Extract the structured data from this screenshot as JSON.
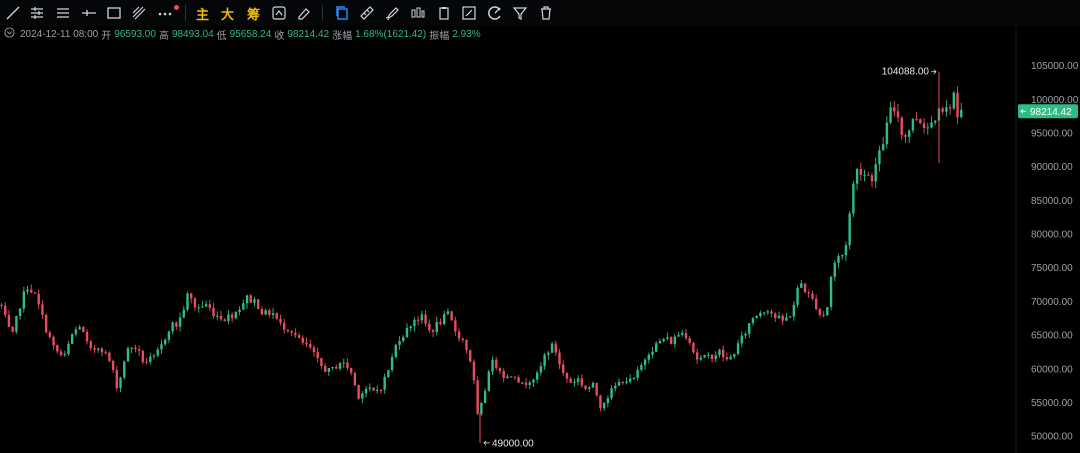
{
  "toolbar": {
    "tools": [
      "trend-line-icon",
      "horizontal-lines-icon",
      "parallel-lines-icon",
      "horizontal-ray-icon",
      "rectangle-icon",
      "fibonacci-icon",
      "more-icon"
    ],
    "indicators": {
      "main": "主",
      "big": "大",
      "chips": "筹"
    },
    "right_tools": [
      "copy-icon",
      "ruler-icon",
      "brush-icon",
      "candle-icon",
      "clipboard-icon",
      "note-icon",
      "magnet-icon",
      "filter-icon",
      "trash-icon"
    ]
  },
  "info": {
    "datetime": "2024-12-11 08:00",
    "open_label": "开",
    "open": "96593.00",
    "high_label": "高",
    "high": "98493.04",
    "low_label": "低",
    "low": "95658.24",
    "close_label": "收",
    "close": "98214.42",
    "change_label": "涨幅",
    "change": "1.68%(1621.42)",
    "amplitude_label": "振幅",
    "amplitude": "2.93%"
  },
  "colors": {
    "up": "#2ebd85",
    "down": "#e84d5f",
    "axis_text": "#9aa0a6",
    "price_tag": "#2ebd85"
  },
  "chart_data": {
    "type": "candlestick",
    "ylim": [
      47500,
      108500
    ],
    "yticks": [
      "105000.00",
      "100000.00",
      "95000.00",
      "90000.00",
      "85000.00",
      "80000.00",
      "75000.00",
      "70000.00",
      "65000.00",
      "60000.00",
      "55000.00",
      "50000.00"
    ],
    "last_price": "98214.42",
    "high_marker": {
      "label": "104088.00",
      "value": 104088
    },
    "low_marker": {
      "label": "49000.00",
      "value": 49000
    },
    "close_path": [
      [
        0,
        70000
      ],
      [
        6,
        67000
      ],
      [
        12,
        64500
      ],
      [
        20,
        69500
      ],
      [
        28,
        72500
      ],
      [
        36,
        70500
      ],
      [
        46,
        66000
      ],
      [
        54,
        63000
      ],
      [
        64,
        61500
      ],
      [
        72,
        65000
      ],
      [
        80,
        66500
      ],
      [
        90,
        62500
      ],
      [
        100,
        63500
      ],
      [
        110,
        61000
      ],
      [
        118,
        57000
      ],
      [
        126,
        62500
      ],
      [
        134,
        63500
      ],
      [
        144,
        61000
      ],
      [
        154,
        61500
      ],
      [
        162,
        63500
      ],
      [
        170,
        66500
      ],
      [
        178,
        66500
      ],
      [
        188,
        71000
      ],
      [
        196,
        69000
      ],
      [
        206,
        69500
      ],
      [
        216,
        68000
      ],
      [
        226,
        67500
      ],
      [
        236,
        68500
      ],
      [
        246,
        70500
      ],
      [
        256,
        70000
      ],
      [
        264,
        68000
      ],
      [
        272,
        68500
      ],
      [
        280,
        66500
      ],
      [
        290,
        66000
      ],
      [
        300,
        64000
      ],
      [
        310,
        63000
      ],
      [
        320,
        60500
      ],
      [
        330,
        59500
      ],
      [
        340,
        61000
      ],
      [
        350,
        60000
      ],
      [
        358,
        56000
      ],
      [
        366,
        57000
      ],
      [
        374,
        56500
      ],
      [
        382,
        57500
      ],
      [
        390,
        60500
      ],
      [
        398,
        64500
      ],
      [
        406,
        65500
      ],
      [
        414,
        67500
      ],
      [
        422,
        67500
      ],
      [
        430,
        65500
      ],
      [
        440,
        67000
      ],
      [
        448,
        68000
      ],
      [
        456,
        65500
      ],
      [
        464,
        64000
      ],
      [
        472,
        60500
      ],
      [
        478,
        52500
      ],
      [
        484,
        56000
      ],
      [
        490,
        61000
      ],
      [
        498,
        60500
      ],
      [
        506,
        58500
      ],
      [
        514,
        59500
      ],
      [
        522,
        57500
      ],
      [
        530,
        58500
      ],
      [
        538,
        59000
      ],
      [
        546,
        62500
      ],
      [
        554,
        63500
      ],
      [
        562,
        59500
      ],
      [
        570,
        58000
      ],
      [
        578,
        58500
      ],
      [
        586,
        57000
      ],
      [
        594,
        57500
      ],
      [
        600,
        54500
      ],
      [
        608,
        56000
      ],
      [
        616,
        57500
      ],
      [
        624,
        58500
      ],
      [
        632,
        58000
      ],
      [
        640,
        60000
      ],
      [
        648,
        62500
      ],
      [
        656,
        63500
      ],
      [
        664,
        64500
      ],
      [
        672,
        64000
      ],
      [
        680,
        65500
      ],
      [
        688,
        65000
      ],
      [
        696,
        61500
      ],
      [
        704,
        61500
      ],
      [
        712,
        62000
      ],
      [
        720,
        62500
      ],
      [
        728,
        61000
      ],
      [
        736,
        63000
      ],
      [
        744,
        65000
      ],
      [
        752,
        67500
      ],
      [
        760,
        68500
      ],
      [
        768,
        69000
      ],
      [
        776,
        67500
      ],
      [
        784,
        67000
      ],
      [
        792,
        68500
      ],
      [
        800,
        73000
      ],
      [
        808,
        71000
      ],
      [
        816,
        69500
      ],
      [
        822,
        67500
      ],
      [
        828,
        69500
      ],
      [
        832,
        75000
      ],
      [
        838,
        76500
      ],
      [
        844,
        77000
      ],
      [
        848,
        80500
      ],
      [
        852,
        86500
      ],
      [
        858,
        90000
      ],
      [
        864,
        89000
      ],
      [
        872,
        88500
      ],
      [
        880,
        92000
      ],
      [
        886,
        95500
      ],
      [
        892,
        99000
      ],
      [
        898,
        97500
      ],
      [
        904,
        94000
      ],
      [
        910,
        96000
      ],
      [
        916,
        97500
      ],
      [
        922,
        96500
      ],
      [
        928,
        96000
      ],
      [
        934,
        97000
      ],
      [
        940,
        100000
      ],
      [
        944,
        98000
      ],
      [
        948,
        98500
      ],
      [
        954,
        101000
      ],
      [
        958,
        96000
      ],
      [
        962,
        98214
      ]
    ]
  }
}
